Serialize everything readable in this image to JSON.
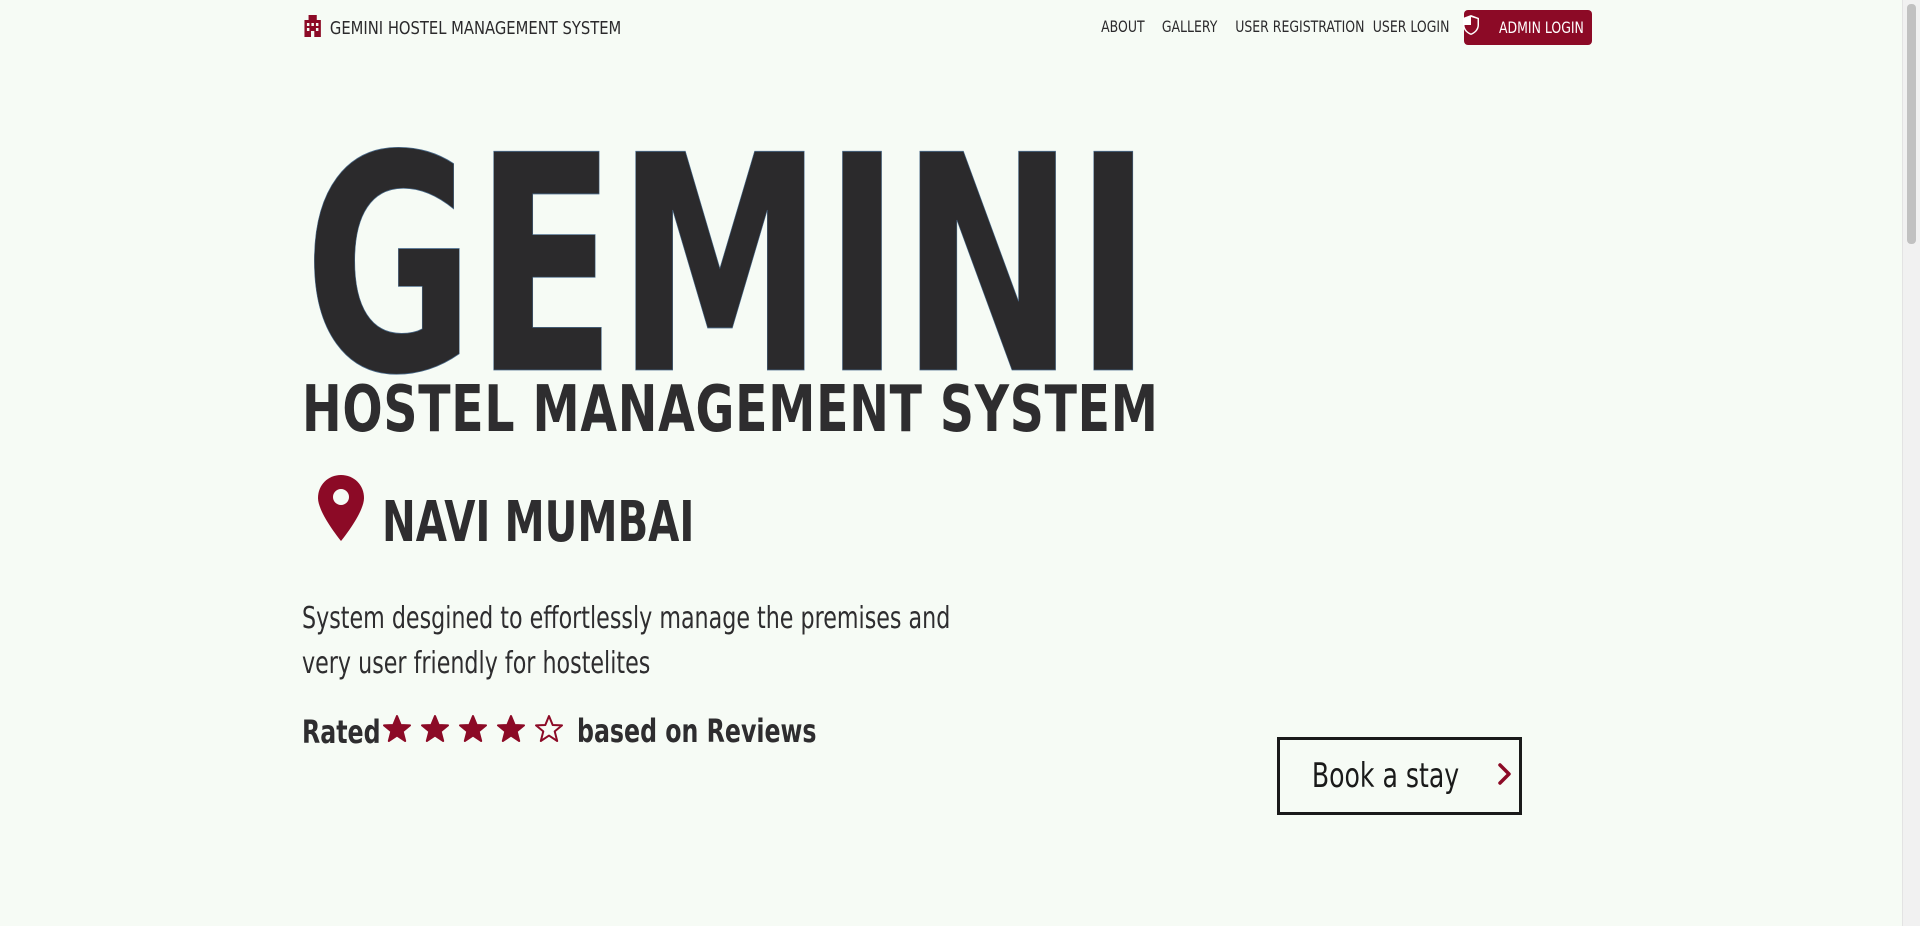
{
  "brand": {
    "name": "GEMINI HOSTEL MANAGEMENT SYSTEM",
    "icon": "building-icon"
  },
  "nav": {
    "items": [
      {
        "label": "ABOUT"
      },
      {
        "label": "GALLERY"
      },
      {
        "label": "USER REGISTRATION"
      },
      {
        "label": "USER LOGIN"
      }
    ],
    "admin_button": {
      "label": "ADMIN LOGIN",
      "icon": "shield-icon"
    }
  },
  "hero": {
    "title": "GEMINI",
    "subtitle": "HOSTEL MANAGEMENT SYSTEM",
    "location": {
      "icon": "map-marker-icon",
      "label": "NAVI MUMBAI"
    },
    "description": "System desgined to effortlessly manage the premises and very user friendly for hostelites",
    "rating": {
      "prefix": "Rated",
      "stars_filled": 4,
      "stars_total": 5,
      "suffix": "based on Reviews"
    },
    "cta": {
      "label": "Book a stay",
      "icon": "chevron-right-icon"
    }
  },
  "colors": {
    "accent": "#8c0a26",
    "background": "#f6fbf5",
    "text": "#2b2a2c"
  }
}
